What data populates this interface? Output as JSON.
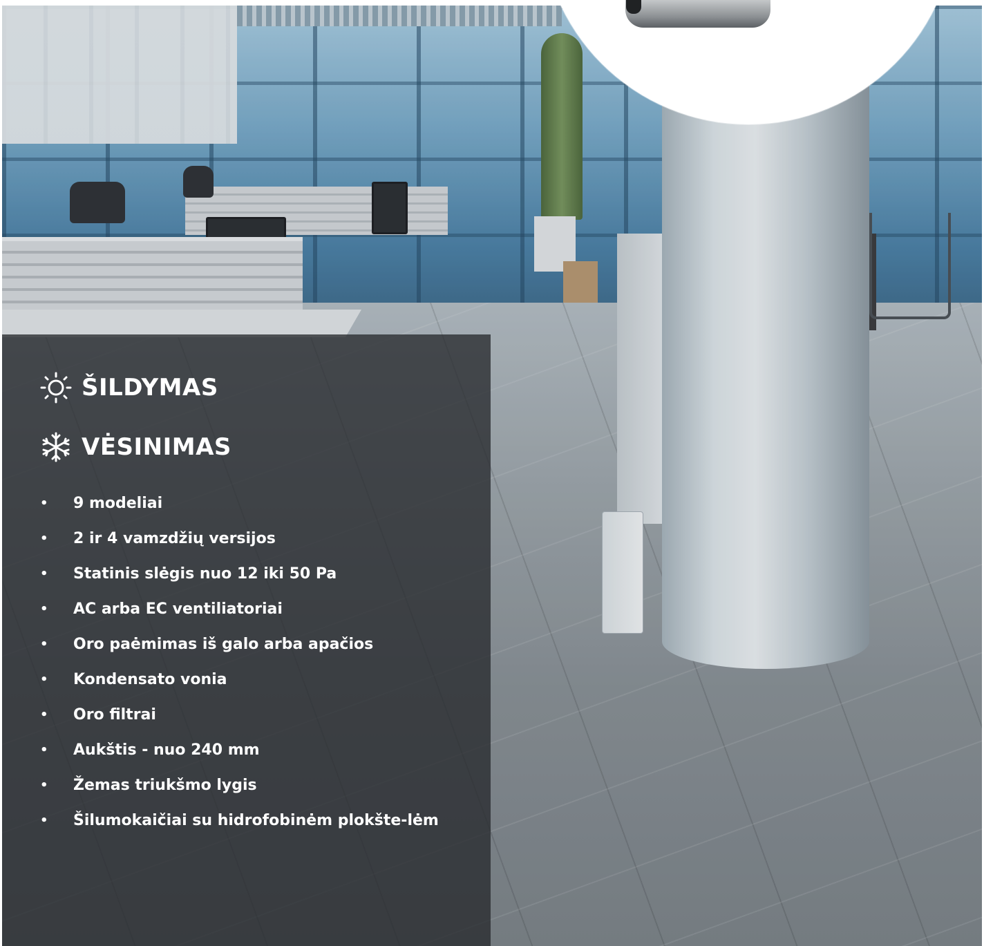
{
  "headings": {
    "heating": "ŠILDYMAS",
    "cooling": "VĖSINIMAS"
  },
  "icons": {
    "heating": "sun-icon",
    "cooling": "snowflake-icon"
  },
  "bullet": "•",
  "features": [
    "9 modeliai",
    "2 ir 4 vamzdžių versijos",
    "Statinis slėgis nuo 12 iki 50 Pa",
    "AC arba EC ventiliatoriai",
    "Oro paėmimas iš galo arba apačios",
    "Kondensato vonia",
    "Oro filtrai",
    "Aukštis - nuo 240 mm",
    "Žemas triukšmo lygis",
    "Šilumokaičiai su hidrofobinėm plokšte-lėm"
  ],
  "colors": {
    "panel": "#2a2c2e",
    "text": "#ffffff",
    "bubble": "#ffffff"
  }
}
